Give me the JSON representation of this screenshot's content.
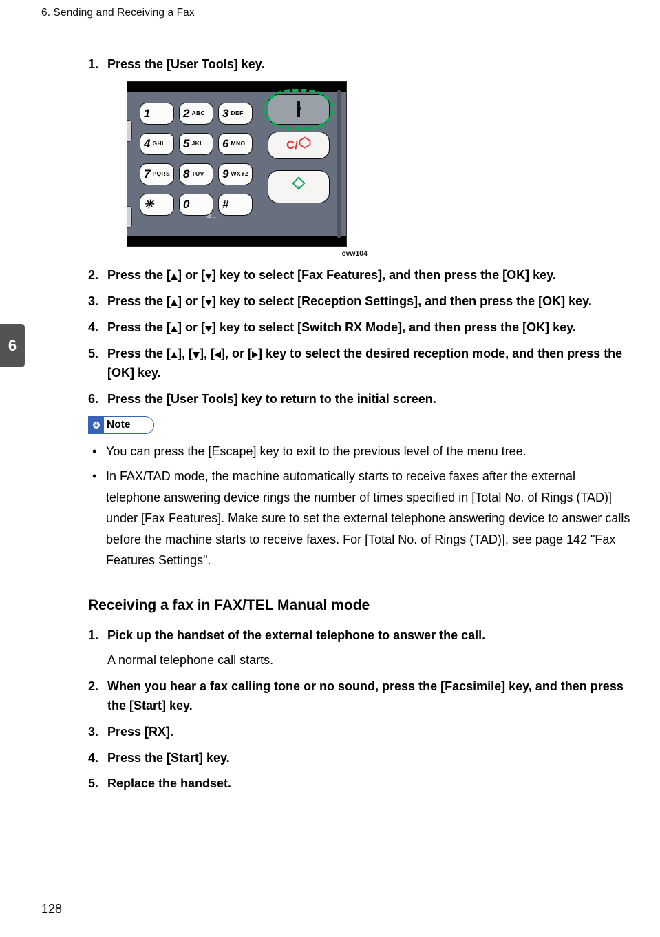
{
  "page": {
    "running_header": "6. Sending and Receiving a Fax",
    "chapter_number": "6",
    "page_number": "128"
  },
  "figure": {
    "reference": "cvw104",
    "keypad": {
      "rows": [
        [
          {
            "digit": "1",
            "letters": ""
          },
          {
            "digit": "2",
            "letters": "ABC"
          },
          {
            "digit": "3",
            "letters": "DEF"
          }
        ],
        [
          {
            "digit": "4",
            "letters": "GHI"
          },
          {
            "digit": "5",
            "letters": "JKL"
          },
          {
            "digit": "6",
            "letters": "MNO"
          }
        ],
        [
          {
            "digit": "7",
            "letters": "PQRS"
          },
          {
            "digit": "8",
            "letters": "TUV"
          },
          {
            "digit": "9",
            "letters": "WXYZ"
          }
        ],
        [
          {
            "digit": "✳",
            "letters": ""
          },
          {
            "digit": "0",
            "letters": ""
          },
          {
            "digit": "#",
            "letters": ""
          }
        ]
      ],
      "above_zero": "- @ _"
    },
    "buttons": {
      "user_tools": "User Tools",
      "clear_stop": "C/",
      "start": "Start"
    }
  },
  "steps_a": {
    "1": "Press the [User Tools] key.",
    "2_parts": [
      "Press the [",
      "] or [",
      "] key to select [Fax Features], and then press the [OK] key."
    ],
    "3_parts": [
      "Press the [",
      "] or [",
      "] key to select [Reception Settings], and then press the [OK] key."
    ],
    "4_parts": [
      "Press the [",
      "] or [",
      "] key to select [Switch RX Mode], and then press the [OK] key."
    ],
    "5_parts": [
      "Press the [",
      "], [",
      "], [",
      "], or [",
      "] key to select the desired reception mode, and then press the [OK] key."
    ],
    "6": "Press the [User Tools] key to return to the initial screen."
  },
  "note": {
    "label": "Note",
    "items": [
      "You can press the [Escape] key to exit to the previous level of the menu tree.",
      "In FAX/TAD mode, the machine automatically starts to receive faxes after the external telephone answering device rings the number of times specified in [Total No. of Rings (TAD)] under [Fax Features]. Make sure to set the external telephone answering device to answer calls before the machine starts to receive faxes. For [Total No. of Rings (TAD)], see page 142 \"Fax Features Settings\"."
    ]
  },
  "section_b": {
    "heading": "Receiving a fax in FAX/TEL Manual mode",
    "steps": {
      "1": "Pick up the handset of the external telephone to answer the call.",
      "1_sub": "A normal telephone call starts.",
      "2": "When you hear a fax calling tone or no sound, press the [Facsimile] key, and then press the [Start] key.",
      "3": "Press [RX].",
      "4": "Press the [Start] key.",
      "5": "Replace the handset."
    }
  }
}
